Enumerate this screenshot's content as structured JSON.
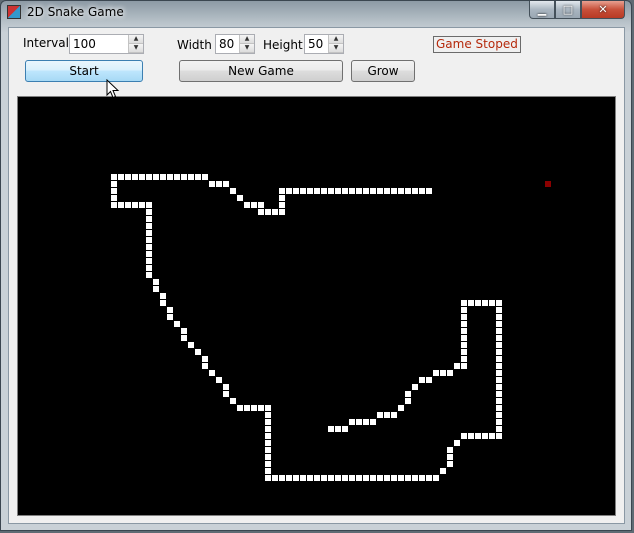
{
  "window": {
    "title": "2D Snake Game",
    "minimize_glyph": "▁",
    "maximize_glyph": "□",
    "close_glyph": "✕"
  },
  "controls": {
    "interval_label": "Interval",
    "interval_value": "100",
    "width_label": "Width",
    "width_value": "80",
    "height_label": "Height",
    "height_value": "50",
    "status_text": "Game Stoped",
    "start_label": "Start",
    "new_game_label": "New Game",
    "grow_label": "Grow",
    "spin_up_glyph": "▲",
    "spin_down_glyph": "▼"
  },
  "board": {
    "background": "#000000",
    "snake_color": "#ffffff",
    "food_color": "#8b0000",
    "food": [
      75,
      12
    ],
    "snake_path": [
      [
        58,
        13
      ],
      [
        37,
        13
      ],
      [
        37,
        16
      ],
      [
        34,
        16
      ],
      [
        34,
        15
      ],
      [
        32,
        15
      ],
      [
        29,
        12
      ],
      [
        27,
        12
      ],
      [
        26,
        11
      ],
      [
        13,
        11
      ],
      [
        13,
        15
      ],
      [
        18,
        15
      ],
      [
        18,
        25
      ],
      [
        21,
        31
      ],
      [
        31,
        44
      ],
      [
        35,
        44
      ],
      [
        35,
        54
      ],
      [
        59,
        54
      ],
      [
        61,
        52
      ],
      [
        61,
        50
      ],
      [
        63,
        48
      ],
      [
        68,
        48
      ],
      [
        68,
        29
      ],
      [
        63,
        29
      ],
      [
        63,
        38
      ],
      [
        59,
        39
      ],
      [
        56,
        41
      ],
      [
        53,
        45
      ],
      [
        48,
        46
      ],
      [
        44,
        47
      ]
    ]
  }
}
